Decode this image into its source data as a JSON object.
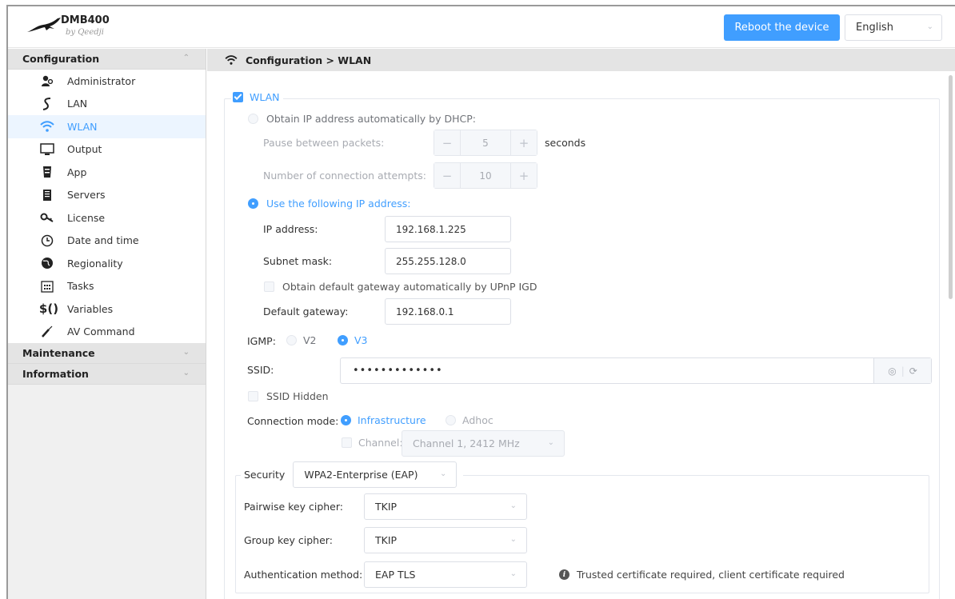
{
  "app": {
    "title": "DMB400",
    "subtitle": "by Qeedji"
  },
  "header": {
    "reboot_label": "Reboot the device",
    "language": "English"
  },
  "sidebar": {
    "sections": [
      {
        "label": "Configuration",
        "expanded": true
      },
      {
        "label": "Maintenance",
        "expanded": false
      },
      {
        "label": "Information",
        "expanded": false
      }
    ],
    "items": [
      {
        "label": "Administrator",
        "icon": "administrator-icon"
      },
      {
        "label": "LAN",
        "icon": "lan-icon"
      },
      {
        "label": "WLAN",
        "icon": "wifi-icon",
        "active": true
      },
      {
        "label": "Output",
        "icon": "monitor-icon"
      },
      {
        "label": "App",
        "icon": "app-icon"
      },
      {
        "label": "Servers",
        "icon": "server-icon"
      },
      {
        "label": "License",
        "icon": "key-icon"
      },
      {
        "label": "Date and time",
        "icon": "clock-icon"
      },
      {
        "label": "Regionality",
        "icon": "globe-icon"
      },
      {
        "label": "Tasks",
        "icon": "calendar-icon"
      },
      {
        "label": "Variables",
        "icon": "variables-icon"
      },
      {
        "label": "AV Command",
        "icon": "remote-icon"
      }
    ]
  },
  "main": {
    "breadcrumb": "Configuration > WLAN",
    "wlan": {
      "label": "WLAN",
      "enabled": true,
      "dhcp": {
        "label": "Obtain IP address automatically by DHCP:",
        "selected": false,
        "pause_label": "Pause between packets:",
        "pause_value": "5",
        "pause_unit": "seconds",
        "attempts_label": "Number of connection attempts:",
        "attempts_value": "10"
      },
      "static": {
        "label": "Use the following IP address:",
        "selected": true,
        "ip_label": "IP address:",
        "ip_value": "192.168.1.225",
        "mask_label": "Subnet mask:",
        "mask_value": "255.255.128.0",
        "upnp_label": "Obtain default gateway automatically by UPnP IGD",
        "upnp_checked": false,
        "gateway_label": "Default gateway:",
        "gateway_value": "192.168.0.1"
      },
      "igmp": {
        "label": "IGMP:",
        "v2": "V2",
        "v3": "V3",
        "selected": "V3"
      },
      "ssid": {
        "label": "SSID:",
        "value": "•••••••••••••",
        "hidden_label": "SSID Hidden",
        "hidden_checked": false
      },
      "connection": {
        "label": "Connection mode:",
        "infrastructure": "Infrastructure",
        "adhoc": "Adhoc",
        "selected": "Infrastructure",
        "channel_label": "Channel:",
        "channel_value": "Channel 1, 2412 MHz"
      },
      "security": {
        "label": "Security",
        "value": "WPA2-Enterprise (EAP)",
        "pairwise_label": "Pairwise key cipher:",
        "pairwise_value": "TKIP",
        "group_label": "Group key cipher:",
        "group_value": "TKIP",
        "auth_label": "Authentication method:",
        "auth_value": "EAP TLS",
        "auth_info": "Trusted certificate required, client certificate required"
      }
    }
  },
  "colors": {
    "accent": "#409eff",
    "sidebar_bg": "#f0f0f0",
    "section_bg": "#e4e4e4"
  }
}
